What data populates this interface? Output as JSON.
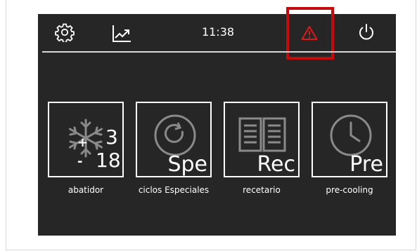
{
  "topbar": {
    "time": "11:38",
    "icons": [
      "settings-gear-icon",
      "chart-trend-icon",
      "alert-triangle-icon",
      "power-icon"
    ],
    "alert_color": "#c40a0a"
  },
  "tiles": [
    {
      "label": "abatidor",
      "icon": "snowflake-icon",
      "plus_value": "3",
      "minus_value": "18",
      "plus_sign": "+",
      "minus_sign": "-"
    },
    {
      "label": "ciclos Especiales",
      "icon": "refresh-cycle-icon",
      "code": "Spe"
    },
    {
      "label": "recetario",
      "icon": "book-icon",
      "code": "Rec"
    },
    {
      "label": "pre-cooling",
      "icon": "clock-icon",
      "code": "Pre"
    }
  ]
}
